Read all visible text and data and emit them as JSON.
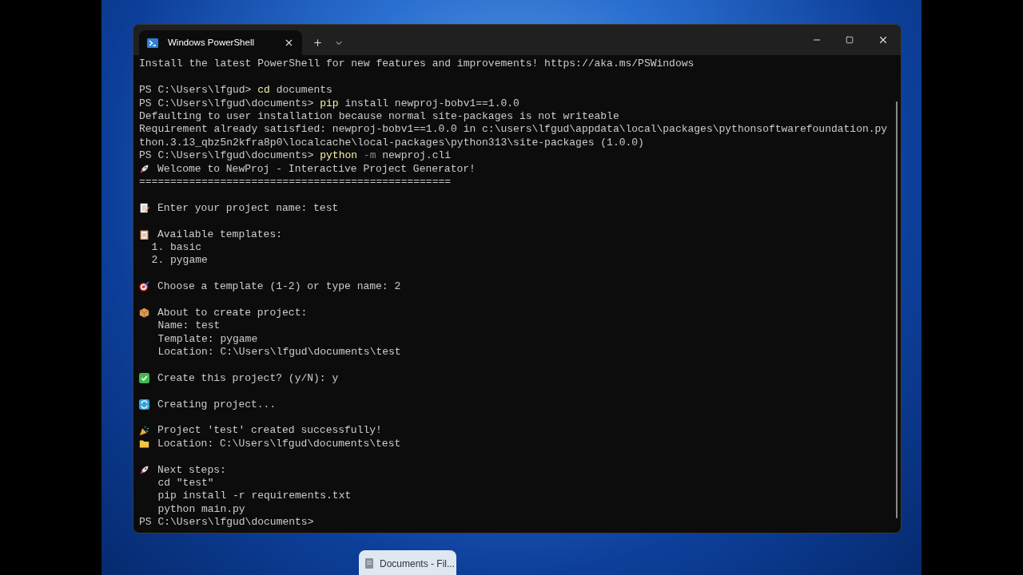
{
  "window": {
    "tab": {
      "title": "Windows PowerShell",
      "selected": true
    }
  },
  "terminal": {
    "blocks": [
      [
        {
          "kind": "text",
          "text": "Install the latest PowerShell for new features and improvements! https://aka.ms/PSWindows"
        }
      ],
      [
        {
          "kind": "prompt",
          "prompt": "PS C:\\Users\\lfgud>",
          "segments": [
            {
              "kind": "command",
              "text": "cd"
            },
            {
              "kind": "arg",
              "text": "documents"
            }
          ]
        },
        {
          "kind": "prompt",
          "prompt": "PS C:\\Users\\lfgud\\documents>",
          "segments": [
            {
              "kind": "command",
              "text": "pip"
            },
            {
              "kind": "arg",
              "text": "install newproj-bobv1==1.0.0"
            }
          ]
        },
        {
          "kind": "text",
          "text": "Defaulting to user installation because normal site-packages is not writeable"
        },
        {
          "kind": "text",
          "text": "Requirement already satisfied: newproj-bobv1==1.0.0 in c:\\users\\lfgud\\appdata\\local\\packages\\pythonsoftwarefoundation.py"
        },
        {
          "kind": "text",
          "text": "thon.3.13_qbz5n2kfra8p0\\localcache\\local-packages\\python313\\site-packages (1.0.0)"
        },
        {
          "kind": "prompt",
          "prompt": "PS C:\\Users\\lfgud\\documents>",
          "segments": [
            {
              "kind": "command",
              "text": "python"
            },
            {
              "kind": "flag",
              "text": "-m"
            },
            {
              "kind": "arg",
              "text": "newproj.cli"
            }
          ]
        },
        {
          "kind": "rocket",
          "text": "Welcome to NewProj - Interactive Project Generator!"
        },
        {
          "kind": "text",
          "text": "=================================================="
        }
      ],
      [
        {
          "kind": "memo",
          "text": "Enter your project name: test"
        }
      ],
      [
        {
          "kind": "clipboard",
          "text": "Available templates:"
        },
        {
          "kind": "text",
          "text": "  1. basic"
        },
        {
          "kind": "text",
          "text": "  2. pygame"
        }
      ],
      [
        {
          "kind": "target",
          "text": "Choose a template (1-2) or type name: 2"
        }
      ],
      [
        {
          "kind": "package",
          "text": "About to create project:"
        },
        {
          "kind": "text",
          "text": "   Name: test"
        },
        {
          "kind": "text",
          "text": "   Template: pygame"
        },
        {
          "kind": "text",
          "text": "   Location: C:\\Users\\lfgud\\documents\\test"
        }
      ],
      [
        {
          "kind": "check",
          "text": "Create this project? (y/N): y"
        }
      ],
      [
        {
          "kind": "refresh",
          "text": "Creating project..."
        }
      ],
      [
        {
          "kind": "party",
          "text": "Project 'test' created successfully!"
        },
        {
          "kind": "folder",
          "text": "Location: C:\\Users\\lfgud\\documents\\test"
        }
      ],
      [
        {
          "kind": "rocket",
          "text": "Next steps:"
        },
        {
          "kind": "text",
          "text": "   cd \"test\""
        },
        {
          "kind": "text",
          "text": "   pip install -r requirements.txt"
        },
        {
          "kind": "text",
          "text": "   python main.py"
        },
        {
          "kind": "prompt",
          "prompt": "PS C:\\Users\\lfgud\\documents>"
        }
      ]
    ]
  },
  "taskbar_preview": {
    "title": "Documents - Fil..."
  }
}
